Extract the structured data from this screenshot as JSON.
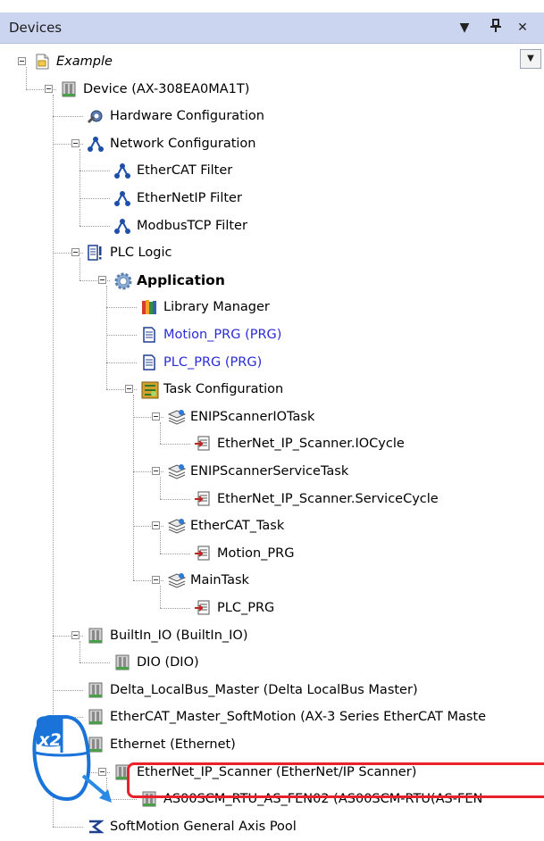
{
  "panel": {
    "title": "Devices",
    "buttons": {
      "dropdown": "▼",
      "pin": "ᵖ",
      "close": "✕"
    }
  },
  "tree": [
    {
      "label": "Example",
      "style": "italic",
      "icon": "project-icon"
    },
    {
      "label": "Device (AX-308EA0MA1T)",
      "icon": "device-icon"
    },
    {
      "label": "Hardware Configuration",
      "icon": "hardware-config-icon"
    },
    {
      "label": "Network Configuration",
      "icon": "network-icon"
    },
    {
      "label": "EtherCAT Filter",
      "icon": "network-icon"
    },
    {
      "label": "EtherNetIP Filter",
      "icon": "network-icon"
    },
    {
      "label": "ModbusTCP Filter",
      "icon": "network-icon"
    },
    {
      "label": "PLC Logic",
      "icon": "plc-logic-icon"
    },
    {
      "label": "Application",
      "style": "bold",
      "icon": "application-gear-icon"
    },
    {
      "label": "Library Manager",
      "icon": "library-books-icon"
    },
    {
      "label": "Motion_PRG (PRG)",
      "style": "link",
      "icon": "program-document-icon"
    },
    {
      "label": "PLC_PRG (PRG)",
      "style": "link",
      "icon": "program-document-icon"
    },
    {
      "label": "Task Configuration",
      "icon": "task-config-icon"
    },
    {
      "label": "ENIPScannerIOTask",
      "icon": "task-stack-icon"
    },
    {
      "label": "EtherNet_IP_Scanner.IOCycle",
      "icon": "call-program-icon"
    },
    {
      "label": "ENIPScannerServiceTask",
      "icon": "task-stack-icon"
    },
    {
      "label": "EtherNet_IP_Scanner.ServiceCycle",
      "icon": "call-program-icon"
    },
    {
      "label": "EtherCAT_Task",
      "icon": "task-stack-icon"
    },
    {
      "label": "Motion_PRG",
      "icon": "call-program-icon"
    },
    {
      "label": "MainTask",
      "icon": "task-stack-icon"
    },
    {
      "label": "PLC_PRG",
      "icon": "call-program-icon"
    },
    {
      "label": "BuiltIn_IO (BuiltIn_IO)",
      "icon": "module-icon"
    },
    {
      "label": "DIO (DIO)",
      "icon": "module-icon"
    },
    {
      "label": "Delta_LocalBus_Master (Delta LocalBus Master)",
      "icon": "module-icon"
    },
    {
      "label": "EtherCAT_Master_SoftMotion (AX-3 Series EtherCAT Maste",
      "icon": "module-icon"
    },
    {
      "label": "Ethernet (Ethernet)",
      "icon": "module-icon"
    },
    {
      "label": "EtherNet_IP_Scanner (EtherNet/IP Scanner)",
      "icon": "module-icon"
    },
    {
      "label": "AS00SCM_RTU_AS_FEN02 (AS00SCM-RTU(AS-FEN",
      "icon": "module-icon"
    },
    {
      "label": "SoftMotion General Axis Pool",
      "icon": "axis-pool-icon"
    }
  ],
  "annotation": {
    "badge": "x2",
    "colors": {
      "highlight": "#e8212a",
      "badge": "#1a73d9",
      "arrow": "#2a8ae6"
    }
  }
}
